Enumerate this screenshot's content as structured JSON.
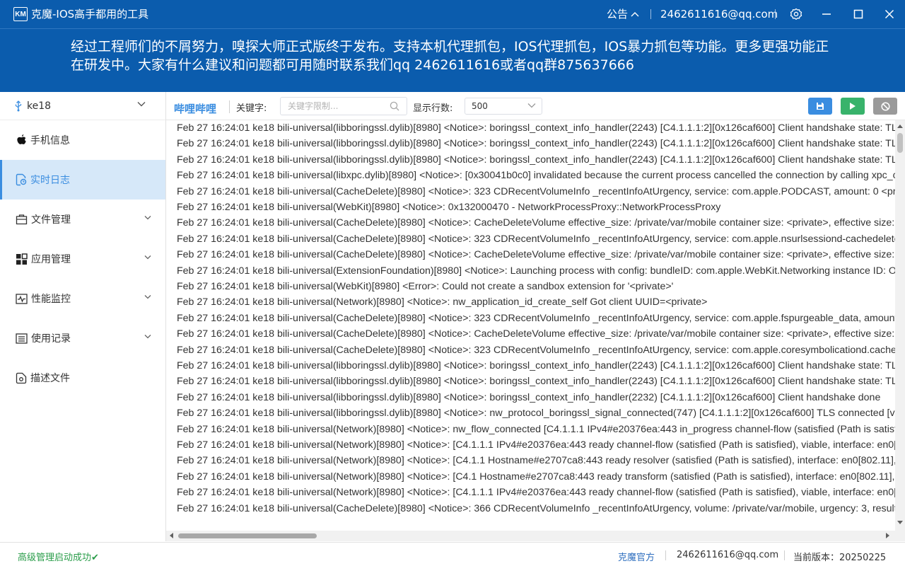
{
  "titlebar": {
    "logo_text": "KM",
    "title": "克魔-IOS高手都用的工具",
    "notice_label": "公告",
    "email": "2462611616@qq.com"
  },
  "banner": {
    "text": "经过工程师们的不屑努力，嗅探大师正式版终于发布。支持本机代理抓包，IOS代理抓包，IOS暴力抓包等功能。更多更强功能正在研发中。大家有什么建议和问题都可用随时联系我们qq 2462611616或者qq群875637666"
  },
  "sidebar": {
    "device": "ke18",
    "items": [
      {
        "label": "手机信息",
        "icon": "apple-icon",
        "active": false,
        "expandable": false
      },
      {
        "label": "实时日志",
        "icon": "log-icon",
        "active": true,
        "expandable": false
      },
      {
        "label": "文件管理",
        "icon": "folder-icon",
        "active": false,
        "expandable": true
      },
      {
        "label": "应用管理",
        "icon": "apps-icon",
        "active": false,
        "expandable": true
      },
      {
        "label": "性能监控",
        "icon": "monitor-icon",
        "active": false,
        "expandable": true
      },
      {
        "label": "使用记录",
        "icon": "record-icon",
        "active": false,
        "expandable": true
      },
      {
        "label": "描述文件",
        "icon": "profile-icon",
        "active": false,
        "expandable": false
      }
    ]
  },
  "toolbar": {
    "app_name": "哔哩哔哩",
    "keyword_label": "关键字:",
    "keyword_placeholder": "关键字限制...",
    "rows_label": "显示行数:",
    "rows_value": "500"
  },
  "log": {
    "lines": [
      "Feb 27 16:24:01 ke18 bili-universal(libboringssl.dylib)[8980] <Notice>: boringssl_context_info_handler(2243) [C4.1.1.1:2][0x126caf600] Client handshake state: TLS",
      "Feb 27 16:24:01 ke18 bili-universal(libboringssl.dylib)[8980] <Notice>: boringssl_context_info_handler(2243) [C4.1.1.1:2][0x126caf600] Client handshake state: TLS",
      "Feb 27 16:24:01 ke18 bili-universal(libboringssl.dylib)[8980] <Notice>: boringssl_context_info_handler(2243) [C4.1.1.1:2][0x126caf600] Client handshake state: TLS",
      "Feb 27 16:24:01 ke18 bili-universal(libxpc.dylib)[8980] <Notice>: [0x30041b0c0] invalidated because the current process cancelled the connection by calling xpc_co",
      "Feb 27 16:24:01 ke18 bili-universal(CacheDelete)[8980] <Notice>: 323 CDRecentVolumeInfo _recentInfoAtUrgency, service: com.apple.PODCAST, amount: 0 <priv",
      "Feb 27 16:24:01 ke18 bili-universal(WebKit)[8980] <Notice>: 0x132000470 - NetworkProcessProxy::NetworkProcessProxy",
      "Feb 27 16:24:01 ke18 bili-universal(CacheDelete)[8980] <Notice>: CacheDeleteVolume effective_size: /private/var/mobile container size: <private>, effective size: <",
      "Feb 27 16:24:01 ke18 bili-universal(CacheDelete)[8980] <Notice>: 323 CDRecentVolumeInfo _recentInfoAtUrgency, service: com.apple.nsurlsessiond-cachedelete,",
      "Feb 27 16:24:01 ke18 bili-universal(CacheDelete)[8980] <Notice>: CacheDeleteVolume effective_size: /private/var/mobile container size: <private>, effective size: <",
      "Feb 27 16:24:01 ke18 bili-universal(ExtensionFoundation)[8980] <Notice>: Launching process with config: bundleID: com.apple.WebKit.Networking instance ID: Opt",
      "Feb 27 16:24:01 ke18 bili-universal(WebKit)[8980] <Error>: Could not create a sandbox extension for '<private>'",
      "Feb 27 16:24:01 ke18 bili-universal(Network)[8980] <Notice>: nw_application_id_create_self Got client UUID=<private>",
      "Feb 27 16:24:01 ke18 bili-universal(CacheDelete)[8980] <Notice>: 323 CDRecentVolumeInfo _recentInfoAtUrgency, service: com.apple.fspurgeable_data, amount:",
      "Feb 27 16:24:01 ke18 bili-universal(CacheDelete)[8980] <Notice>: CacheDeleteVolume effective_size: /private/var/mobile container size: <private>, effective size: <",
      "Feb 27 16:24:01 ke18 bili-universal(CacheDelete)[8980] <Notice>: 323 CDRecentVolumeInfo _recentInfoAtUrgency, service: com.apple.coresymbolicationd.cache-d",
      "Feb 27 16:24:01 ke18 bili-universal(libboringssl.dylib)[8980] <Notice>: boringssl_context_info_handler(2243) [C4.1.1.1:2][0x126caf600] Client handshake state: TLS",
      "Feb 27 16:24:01 ke18 bili-universal(libboringssl.dylib)[8980] <Notice>: boringssl_context_info_handler(2243) [C4.1.1.1:2][0x126caf600] Client handshake state: TLS",
      "Feb 27 16:24:01 ke18 bili-universal(libboringssl.dylib)[8980] <Notice>: boringssl_context_info_handler(2232) [C4.1.1.1:2][0x126caf600] Client handshake done",
      "Feb 27 16:24:01 ke18 bili-universal(libboringssl.dylib)[8980] <Notice>: nw_protocol_boringssl_signal_connected(747) [C4.1.1.1:2][0x126caf600] TLS connected [ver",
      "Feb 27 16:24:01 ke18 bili-universal(Network)[8980] <Notice>: nw_flow_connected [C4.1.1.1 IPv4#e20376ea:443 in_progress channel-flow (satisfied (Path is satisfie",
      "Feb 27 16:24:01 ke18 bili-universal(Network)[8980] <Notice>: [C4.1.1.1 IPv4#e20376ea:443 ready channel-flow (satisfied (Path is satisfied), viable, interface: en0[80",
      "Feb 27 16:24:01 ke18 bili-universal(Network)[8980] <Notice>: [C4.1.1 Hostname#e2707ca8:443 ready resolver (satisfied (Path is satisfied), interface: en0[802.11], ip",
      "Feb 27 16:24:01 ke18 bili-universal(Network)[8980] <Notice>: [C4.1 Hostname#e2707ca8:443 ready transform (satisfied (Path is satisfied), interface: en0[802.11], ip",
      "Feb 27 16:24:01 ke18 bili-universal(Network)[8980] <Notice>: [C4.1.1.1 IPv4#e20376ea:443 ready channel-flow (satisfied (Path is satisfied), viable, interface: en0[80",
      "Feb 27 16:24:01 ke18 bili-universal(CacheDelete)[8980] <Notice>: 366 CDRecentVolumeInfo _recentInfoAtUrgency, volume: /private/var/mobile, urgency: 3, result:"
    ]
  },
  "statusbar": {
    "status_text": "高级管理启动成功✔",
    "official_link": "克魔官方",
    "email": "2462611616@qq.com",
    "version": "当前版本：20250225"
  },
  "colors": {
    "brand_blue": "#0b5cad",
    "accent_blue": "#3a8de0",
    "active_bg": "#d6e8f9",
    "success_green": "#2a9d4a",
    "play_green": "#38b36b",
    "stop_gray": "#9a9a9a"
  }
}
